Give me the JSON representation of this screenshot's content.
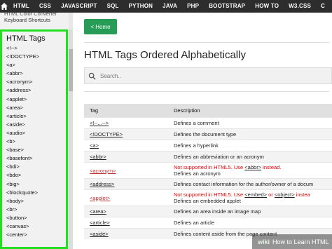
{
  "topnav": {
    "items": [
      "HTML",
      "CSS",
      "JAVASCRIPT",
      "SQL",
      "PYTHON",
      "JAVA",
      "PHP",
      "BOOTSTRAP",
      "HOW TO",
      "W3.CSS",
      "C",
      "C"
    ]
  },
  "sidebar_top": {
    "cut_text": "HTML Color Converter",
    "link": "Keyboard Shortcuts"
  },
  "sidebar": {
    "heading": "HTML Tags",
    "items": [
      "<!-->",
      "<!DOCTYPE>",
      "<a>",
      "<abbr>",
      "<acronym>",
      "<address>",
      "<applet>",
      "<area>",
      "<article>",
      "<aside>",
      "<audio>",
      "<b>",
      "<base>",
      "<basefont>",
      "<bdi>",
      "<bdo>",
      "<big>",
      "<blockquote>",
      "<body>",
      "<br>",
      "<button>",
      "<canvas>",
      "<center>"
    ]
  },
  "main": {
    "home_button": "< Home",
    "title": "HTML Tags Ordered Alphabetically",
    "search_placeholder": "Search..",
    "table": {
      "headers": [
        "Tag",
        "Description"
      ],
      "rows": [
        {
          "tag": "<!--...-->",
          "desc": "Defines a comment"
        },
        {
          "tag": "<!DOCTYPE>",
          "desc": "Defines the document type"
        },
        {
          "tag": "<a>",
          "desc": "Defines a hyperlink"
        },
        {
          "tag": "<abbr>",
          "desc": "Defines an abbreviation or an acronym"
        },
        {
          "tag": "<acronym>",
          "warn_pre": "Not supported in HTML5. Use ",
          "warn_link": "<abbr>",
          "warn_post": " instead.",
          "desc": "Defines an acronym"
        },
        {
          "tag": "<address>",
          "desc": "Defines contact information for the author/owner of a docum"
        },
        {
          "tag": "<applet>",
          "warn_pre": "Not supported in HTML5. Use ",
          "warn_link": "<embed>",
          "warn_mid": " or ",
          "warn_link2": "<object>",
          "warn_post": " instea",
          "desc": "Defines an embedded applet"
        },
        {
          "tag": "<area>",
          "desc": "Defines an area inside an image map"
        },
        {
          "tag": "<article>",
          "desc": "Defines an article"
        },
        {
          "tag": "<aside>",
          "desc": "Defines content aside from the page content"
        }
      ]
    }
  },
  "watermark": {
    "brand": "wiki",
    "text": "How to Learn HTML"
  },
  "colors": {
    "nav_bg": "#2d2d2d",
    "home_green": "#279c57",
    "highlight_green": "#22e01f",
    "warning_red": "#e00000"
  }
}
